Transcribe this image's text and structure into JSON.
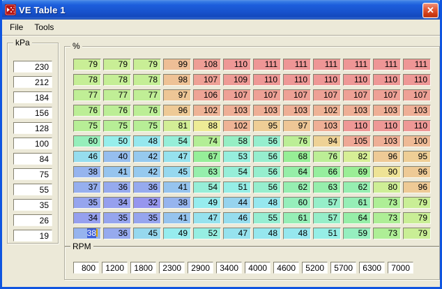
{
  "window": {
    "title": "VE Table 1"
  },
  "menu": {
    "items": [
      "File",
      "Tools"
    ]
  },
  "axes": {
    "y": {
      "label": "kPa",
      "values": [
        230,
        212,
        184,
        156,
        128,
        100,
        84,
        75,
        55,
        35,
        26,
        19
      ]
    },
    "x": {
      "label": "RPM",
      "values": [
        800,
        1200,
        1800,
        2300,
        2900,
        3400,
        4000,
        4600,
        5200,
        5700,
        6300,
        7000
      ]
    }
  },
  "table": {
    "label": "%",
    "rows": [
      [
        79,
        79,
        79,
        99,
        108,
        110,
        111,
        111,
        111,
        111,
        111,
        111
      ],
      [
        78,
        78,
        78,
        98,
        107,
        109,
        110,
        110,
        110,
        110,
        110,
        110
      ],
      [
        77,
        77,
        77,
        97,
        106,
        107,
        107,
        107,
        107,
        107,
        107,
        107
      ],
      [
        76,
        76,
        76,
        96,
        102,
        103,
        103,
        103,
        102,
        103,
        103,
        103
      ],
      [
        75,
        75,
        75,
        81,
        88,
        102,
        95,
        97,
        103,
        110,
        110,
        110
      ],
      [
        60,
        50,
        48,
        54,
        74,
        58,
        56,
        76,
        94,
        105,
        103,
        100
      ],
      [
        46,
        40,
        42,
        47,
        67,
        53,
        56,
        68,
        76,
        82,
        96,
        95
      ],
      [
        38,
        41,
        42,
        45,
        63,
        54,
        56,
        64,
        66,
        69,
        90,
        96
      ],
      [
        37,
        36,
        36,
        41,
        54,
        51,
        56,
        62,
        63,
        62,
        80,
        96
      ],
      [
        35,
        34,
        32,
        38,
        49,
        44,
        48,
        60,
        57,
        61,
        73,
        79
      ],
      [
        34,
        35,
        35,
        41,
        47,
        46,
        55,
        61,
        57,
        64,
        73,
        79
      ],
      [
        38,
        36,
        45,
        49,
        52,
        47,
        48,
        48,
        51,
        59,
        73,
        79
      ]
    ],
    "selected": {
      "row": 11,
      "col": 0,
      "value": 38
    }
  },
  "heatmap": {
    "min": 32,
    "max": 111,
    "hue_low": 240,
    "hue_high": 0,
    "gamma": 1.15,
    "saturation": 72,
    "lightness": 76,
    "low_color": "#9696ee",
    "high_color": "#ee9696"
  },
  "icons": {
    "app_icon": "megasquirt-logo-icon",
    "close": "close-icon"
  },
  "colors": {
    "titlebar_top": "#5c96e8",
    "titlebar_mid": "#1853cd",
    "titlebar_bottom": "#123f9e",
    "window_border": "#0f55e0",
    "face": "#ece9d8",
    "close_button": "#cc3912",
    "selection": "#3e5fd7",
    "caret": "#e0a800",
    "field_bg": "#ffffff",
    "text": "#000000"
  }
}
